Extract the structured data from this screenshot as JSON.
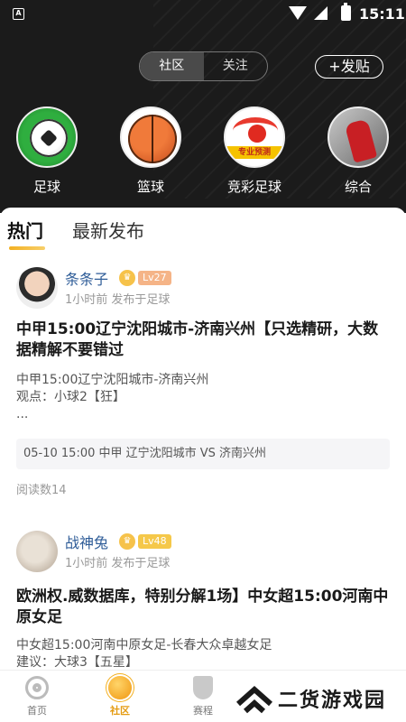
{
  "status_bar": {
    "app_icon_letter": "A",
    "time": "15:11"
  },
  "header": {
    "segments": [
      {
        "label": "社区",
        "active": true
      },
      {
        "label": "关注",
        "active": false
      }
    ],
    "post_button": "+发贴"
  },
  "categories": [
    {
      "label": "足球",
      "icon": "soccer-icon"
    },
    {
      "label": "篮球",
      "icon": "basketball-icon"
    },
    {
      "label": "竞彩足球",
      "icon": "lottery-icon",
      "icon_text": "专业预测"
    },
    {
      "label": "综合",
      "icon": "misc-icon"
    }
  ],
  "tabs": [
    {
      "label": "热门",
      "active": true
    },
    {
      "label": "最新发布",
      "active": false
    }
  ],
  "posts": [
    {
      "username": "条条子",
      "level": "Lv27",
      "level_color": "#f5b487",
      "meta": "1小时前 发布于足球",
      "title": "中甲15:00辽宁沈阳城市-济南兴州【只选精研，大数据精解不要错过",
      "summary_lines": [
        "中甲15:00辽宁沈阳城市-济南兴州",
        "观点：小球2【狂】",
        "..."
      ],
      "match": "05-10 15:00 中甲 辽宁沈阳城市 VS 济南兴州",
      "reads": "阅读数14"
    },
    {
      "username": "战神兔",
      "level": "Lv48",
      "level_color": "#f5c84a",
      "meta": "1小时前 发布于足球",
      "title": "欧洲权.威数据库，特别分解1场】中女超15:00河南中原女足",
      "summary_lines": [
        "中女超15:00河南中原女足-长春大众卓越女足",
        "建议：大球3【五星】"
      ]
    }
  ],
  "bottom_nav": [
    {
      "label": "首页",
      "icon": "home-icon",
      "active": false
    },
    {
      "label": "社区",
      "icon": "community-planet-icon",
      "active": true
    },
    {
      "label": "赛程",
      "icon": "trophy-icon",
      "active": false
    }
  ],
  "watermark": {
    "text": "二货游戏园"
  },
  "colors": {
    "accent": "#f3b021",
    "username": "#2f5d98",
    "header_bg": "#1b1b1b"
  }
}
